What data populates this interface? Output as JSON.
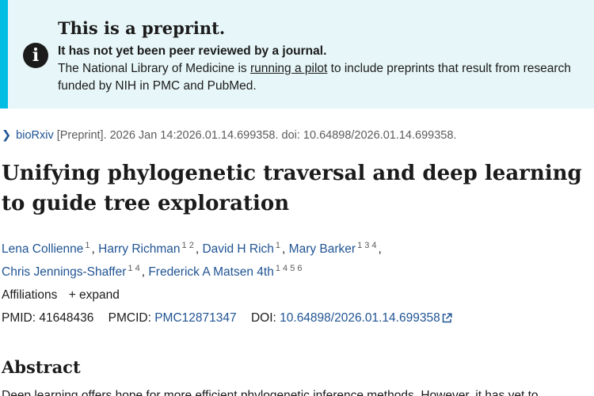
{
  "banner": {
    "icon": "info-icon",
    "title": "This is a preprint.",
    "strong": "It has not yet been peer reviewed by a journal.",
    "text_before": "The National Library of Medicine is ",
    "link": "running a pilot",
    "text_after": " to include preprints that result from research funded by NIH in PMC and PubMed."
  },
  "citation": {
    "source_link": "bioRxiv",
    "text": "[Preprint]. 2026 Jan 14:2026.01.14.699358. doi: 10.64898/2026.01.14.699358."
  },
  "title": "Unifying phylogenetic traversal and deep learning to guide tree exploration",
  "authors": [
    {
      "name": "Lena Collienne",
      "affil": "1"
    },
    {
      "name": "Harry Richman",
      "affil": "1 2"
    },
    {
      "name": "David H Rich",
      "affil": "1"
    },
    {
      "name": "Mary Barker",
      "affil": "1 3 4"
    },
    {
      "name": "Chris Jennings-Shaffer",
      "affil": "1 4"
    },
    {
      "name": "Frederick A Matsen 4th",
      "affil": "1 4 5 6"
    }
  ],
  "affiliations": {
    "label": "Affiliations",
    "expand": "+ expand"
  },
  "ids": {
    "pmid_label": "PMID:",
    "pmid": "41648436",
    "pmcid_label": "PMCID:",
    "pmcid": "PMC12871347",
    "doi_label": "DOI:",
    "doi": "10.64898/2026.01.14.699358"
  },
  "abstract": {
    "heading": "Abstract",
    "text_start": "Deep learning offers hope for more efficient phylogenetic inference methods. However, it has yet to"
  }
}
